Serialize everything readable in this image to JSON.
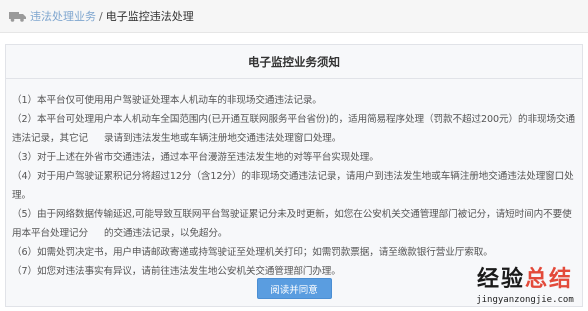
{
  "breadcrumb": {
    "icon": "truck-icon",
    "parent": "违法处理业务",
    "separator": "/",
    "current": "电子监控违法处理"
  },
  "notice": {
    "title": "电子监控业务须知",
    "clauses": [
      "（1）本平台仅可使用用户驾驶证处理本人机动车的非现场交通违法记录。",
      "（2）本平台可处理用户本人机动车全国范围内(已开通互联网服务平台省份)的，适用简易程序处理（罚款不超过200元）的非现场交通违法记录，其它记",
      "录请到违法发生地或车辆注册地交通违法处理窗口处理。",
      "（3）对于上述在外省市交通违法，通过本平台漫游至违法发生地的对等平台实现处理。",
      "（4）对于用户驾驶证累积记分将超过12分（含12分）的非现场交通违法记录，请用户到违法发生地或车辆注册地交通违法处理窗口处理。",
      "（5）由于网络数据传输延迟,可能导致互联网平台驾驶证累记分未及时更新，如您在公安机关交通管理部门被记分，请短时间内不要使用本平台处理记分",
      "的交通违法记录，以免超分。",
      "（6）如需处罚决定书，用户申请邮政寄递或持驾驶证至处理机关打印；如需罚款票据，请至缴款银行营业厅索取。",
      "（7）如您对违法事实有异议，请前往违法发生地公安机关交通管理部门办理。"
    ],
    "agree_button": "阅读并同意"
  },
  "watermark": {
    "brand_black": "经验",
    "brand_red": "总结",
    "url": "jingyanzongjie.com"
  },
  "colors": {
    "link": "#7fa6cf",
    "button": "#5a9de0",
    "panel_bg": "#f7f8fa",
    "watermark_red": "#e34a3a"
  }
}
